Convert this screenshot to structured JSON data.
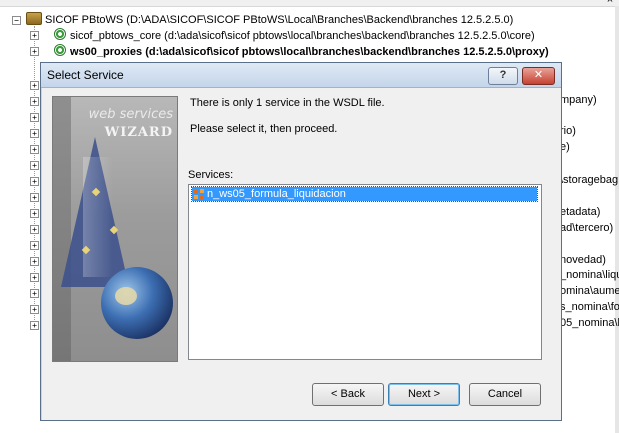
{
  "tree": {
    "root_label": "SICOF PBtoWS (D:\\ADA\\SICOF\\SICOF PBtoWS\\Local\\Branches\\Backend\\branches 12.5.2.5.0)",
    "items": [
      {
        "label": "sicof_pbtows_core (d:\\ada\\sicof\\sicof pbtows\\local\\branches\\backend\\branches 12.5.2.5.0\\core)"
      },
      {
        "label": "ws00_proxies (d:\\ada\\sicof\\sicof pbtows\\local\\branches\\backend\\branches 12.5.2.5.0\\proxy)"
      }
    ],
    "partial_right_texts": [
      "mpany)",
      "rio)",
      "e)",
      "\\storagebag",
      "etadata)",
      "ad\\tercero)",
      "novedad)",
      "_nomina\\liqu",
      "omina\\aume",
      "s_nomina\\for",
      "05_nomina\\li"
    ]
  },
  "dialog": {
    "title": "Select Service",
    "help_label": "?",
    "close_label": "✕",
    "image": {
      "line1": "web services",
      "line2": "WIZARD"
    },
    "message1": "There is only 1 service in the WSDL file.",
    "message2": "Please select it, then proceed.",
    "services_label": "Services:",
    "services": [
      "n_ws05_formula_liquidacion"
    ],
    "buttons": {
      "back": "< Back",
      "next": "Next >",
      "cancel": "Cancel"
    }
  }
}
